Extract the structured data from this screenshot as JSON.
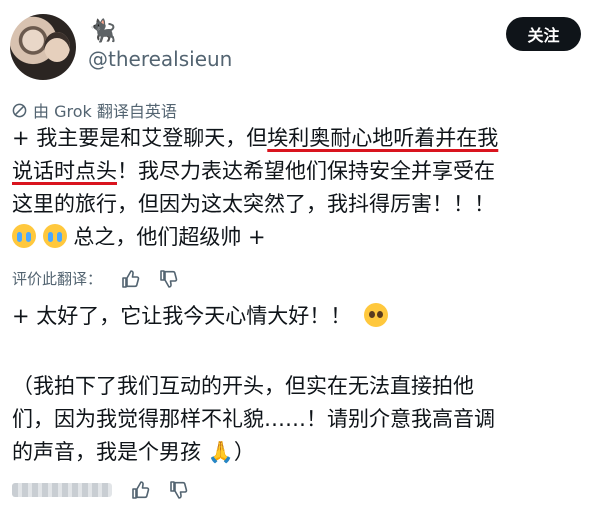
{
  "user": {
    "handle": "@therealsieun",
    "name_icon": "black-cat-icon",
    "avatar_alt": ""
  },
  "actions": {
    "follow": "关注"
  },
  "translation": {
    "note": "由 Grok 翻译自英语",
    "rate_label": "评价此翻译："
  },
  "post": {
    "p1_lines": [
      [
        "+ 我主要是和艾登聊天，但",
        "埃利奥耐心地听着并在我"
      ],
      [
        "说话时点头",
        "！我尽力表达希望他们保持安全并享受在"
      ],
      [
        "这里的旅行，但因为这太突然了，我抖得厉害！！！"
      ],
      [
        "",
        "总之，他们超级帅 +"
      ]
    ],
    "p2": "+ 太好了，它让我今天心情大好！！",
    "p3_lines": [
      "（我拍下了我们互动的开头，但实在无法直接拍他",
      "们，因为我觉得那样不礼貌……！请别介意我高音调",
      "的声音，我是个男孩"
    ],
    "p3_end": "）"
  },
  "colors": {
    "underline": "#d9141e",
    "follow_bg": "#0f1419",
    "muted": "#536471"
  }
}
